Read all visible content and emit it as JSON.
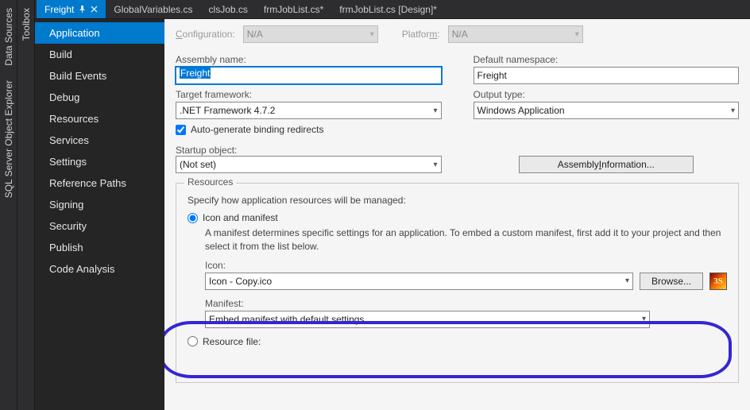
{
  "toolwells": {
    "left1": [
      "Data Sources",
      "SQL Server Object Explorer"
    ],
    "left2": [
      "Toolbox"
    ]
  },
  "doc_tabs": [
    {
      "label": "Freight",
      "active": true,
      "pinned": true
    },
    {
      "label": "GlobalVariables.cs",
      "active": false
    },
    {
      "label": "clsJob.cs",
      "active": false
    },
    {
      "label": "frmJobList.cs*",
      "active": false
    },
    {
      "label": "frmJobList.cs [Design]*",
      "active": false
    }
  ],
  "side_nav": [
    "Application",
    "Build",
    "Build Events",
    "Debug",
    "Resources",
    "Services",
    "Settings",
    "Reference Paths",
    "Signing",
    "Security",
    "Publish",
    "Code Analysis"
  ],
  "side_nav_active": 0,
  "form": {
    "configuration_label": "Configuration:",
    "configuration_value": "N/A",
    "platform_label": "Platform:",
    "platform_value": "N/A",
    "assembly_label": "Assembly name:",
    "assembly_value": "Freight",
    "namespace_label": "Default namespace:",
    "namespace_value": "Freight",
    "target_fw_label": "Target framework:",
    "target_fw_value": ".NET Framework 4.7.2",
    "output_type_label": "Output type:",
    "output_type_value": "Windows Application",
    "autogen_label": "Auto-generate binding redirects",
    "autogen_checked": true,
    "startup_label": "Startup object:",
    "startup_value": "(Not set)",
    "assembly_info_btn": "Assembly Information...",
    "resources_legend": "Resources",
    "resources_help": "Specify how application resources will be managed:",
    "icon_manifest_radio": "Icon and manifest",
    "manifest_note": "A manifest determines specific settings for an application. To embed a custom manifest, first add it to your project and then select it from the list below.",
    "icon_label": "Icon:",
    "icon_value": "Icon - Copy.ico",
    "browse_btn": "Browse...",
    "icon_preview_text": "3S",
    "manifest_label": "Manifest:",
    "manifest_value": "Embed manifest with default settings",
    "resource_file_radio": "Resource file:"
  }
}
